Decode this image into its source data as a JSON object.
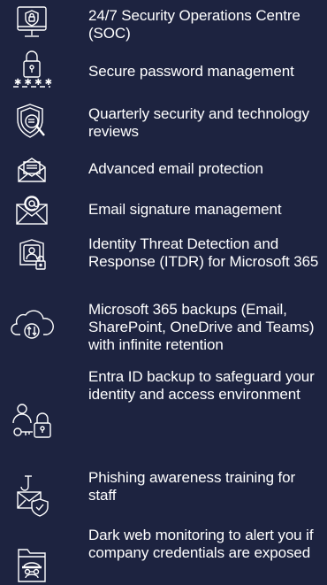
{
  "features": [
    {
      "icon": "monitor-shield-icon",
      "text": "24/7 Security Operations Centre (SOC)"
    },
    {
      "icon": "padlock-password-icon",
      "text": "Secure password management"
    },
    {
      "icon": "shield-search-icon",
      "text": "Quarterly security and technology reviews"
    },
    {
      "icon": "email-protection-icon",
      "text": "Advanced email protection"
    },
    {
      "icon": "email-signature-icon",
      "text": "Email signature management"
    },
    {
      "icon": "identity-shield-icon",
      "text": "Identity Threat Detection and Response (ITDR) for Microsoft 365"
    },
    {
      "icon": "cloud-sync-icon",
      "text": "Microsoft 365 backups (Email, SharePoint, OneDrive and Teams) with infinite retention"
    },
    {
      "icon": "user-key-lock-icon",
      "text": "Entra ID backup to safeguard your identity and access environment"
    },
    {
      "icon": "phishing-email-icon",
      "text": "Phishing awareness training for staff"
    },
    {
      "icon": "dark-web-monitor-icon",
      "text": "Dark web monitoring to alert you if company credentials are exposed"
    }
  ],
  "colors": {
    "background": "#1d2340",
    "text": "#ffffff",
    "icon_stroke": "#ffffff"
  }
}
